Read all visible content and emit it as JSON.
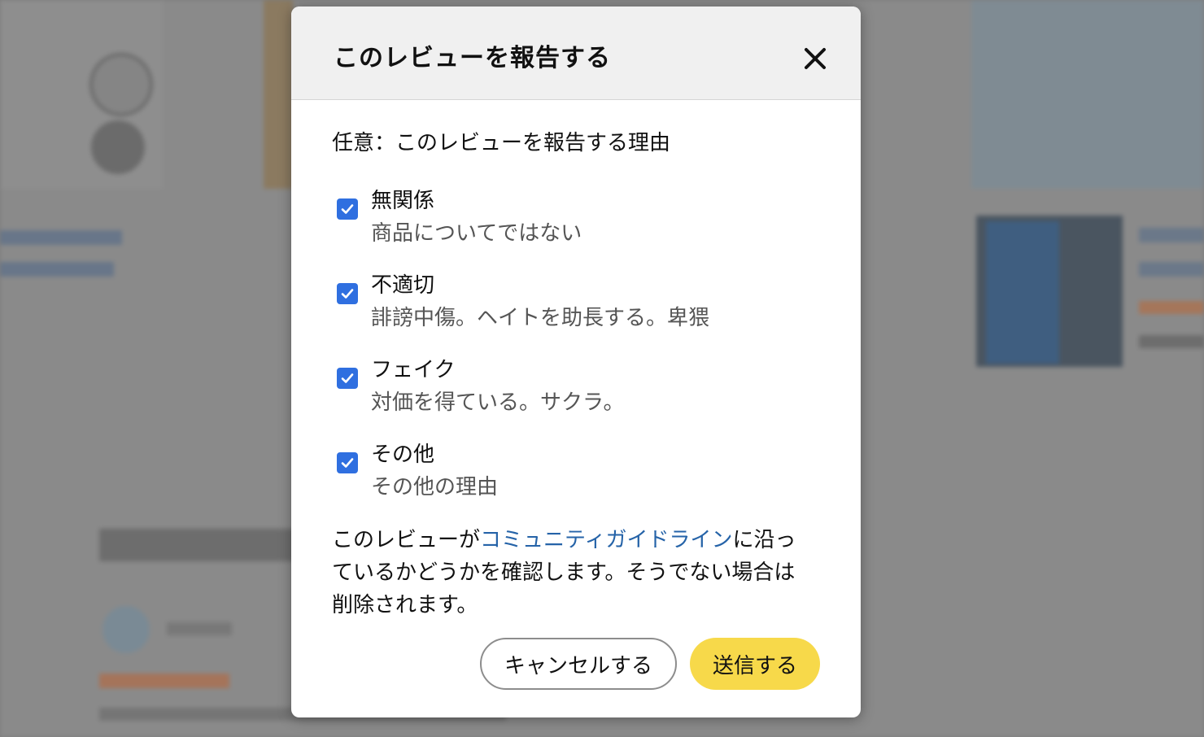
{
  "dialog": {
    "title": "このレビューを報告する",
    "close_icon": "close-icon",
    "prompt": "任意：このレビューを報告する理由",
    "options": [
      {
        "title": "無関係",
        "description": "商品についてではない",
        "checked": true
      },
      {
        "title": "不適切",
        "description": "誹謗中傷。ヘイトを助長する。卑猥",
        "checked": true
      },
      {
        "title": "フェイク",
        "description": "対価を得ている。サクラ。",
        "checked": true
      },
      {
        "title": "その他",
        "description": "その他の理由",
        "checked": true
      }
    ],
    "notice_before": "このレビューが",
    "notice_link": "コミュニティガイドライン",
    "notice_after": "に沿っているかどうかを確認します。そうでない場合は削除されます。",
    "cancel_label": "キャンセルする",
    "submit_label": "送信する"
  },
  "colors": {
    "checkbox": "#2f6fe0",
    "link": "#2563a8",
    "submit_button": "#f7d94a",
    "header_bg": "#f0f0f0"
  }
}
